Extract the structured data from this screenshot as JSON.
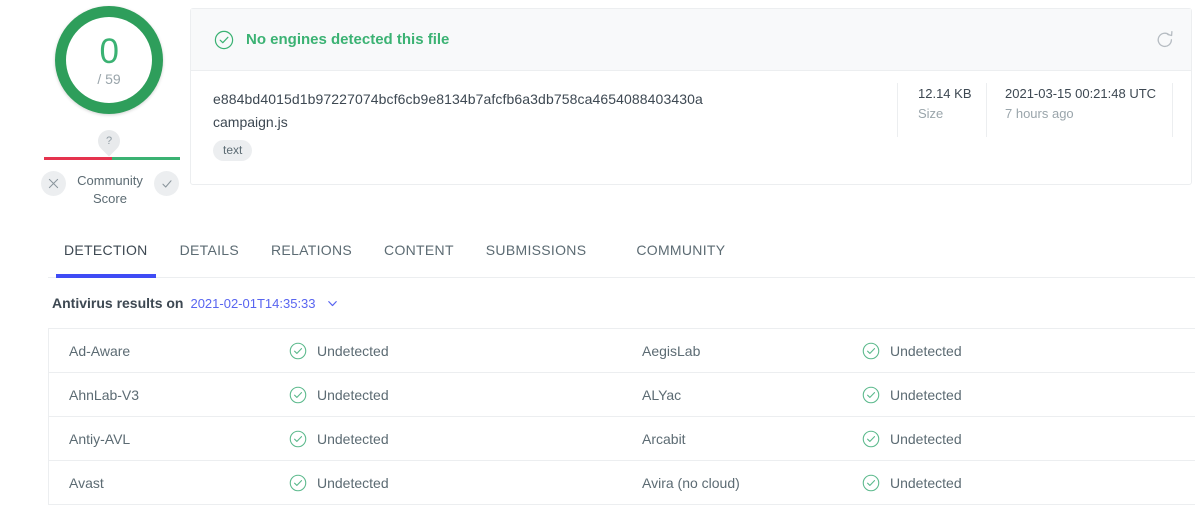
{
  "score": {
    "detections": "0",
    "total": "/ 59",
    "ring_color": "#2e9e5b",
    "count_color": "#3bb273"
  },
  "community": {
    "pin_label": "?",
    "label": "Community Score",
    "negative_icon": "close-icon",
    "positive_icon": "check-icon",
    "bar_negative_color": "#e5334e",
    "bar_positive_color": "#3bb273"
  },
  "verdict": {
    "icon": "check-circle-icon",
    "text": "No engines detected this file",
    "color": "#3bb273",
    "reload_icon": "reload-icon"
  },
  "file": {
    "hash": "e884bd4015d1b97227074bcf6cb9e8134b7afcfb6a3db758ca4654088403430a",
    "name": "campaign.js",
    "tag": "text",
    "meta": [
      {
        "value": "12.14 KB",
        "label": "Size"
      },
      {
        "value": "2021-03-15 00:21:48 UTC",
        "label": "7 hours ago"
      }
    ]
  },
  "tabs": [
    {
      "label": "DETECTION",
      "active": true
    },
    {
      "label": "DETAILS",
      "active": false
    },
    {
      "label": "RELATIONS",
      "active": false
    },
    {
      "label": "CONTENT",
      "active": false
    },
    {
      "label": "SUBMISSIONS",
      "active": false
    },
    {
      "label": "COMMUNITY",
      "active": false
    }
  ],
  "active_tab_color": "#3f4cf5",
  "results": {
    "title": "Antivirus results on",
    "date": "2021-02-01T14:35:33",
    "chevron_icon": "chevron-down-icon",
    "rows": [
      {
        "left": {
          "engine": "Ad-Aware",
          "status": "Undetected",
          "icon": "check-circle-icon"
        },
        "right": {
          "engine": "AegisLab",
          "status": "Undetected",
          "icon": "check-circle-icon"
        }
      },
      {
        "left": {
          "engine": "AhnLab-V3",
          "status": "Undetected",
          "icon": "check-circle-icon"
        },
        "right": {
          "engine": "ALYac",
          "status": "Undetected",
          "icon": "check-circle-icon"
        }
      },
      {
        "left": {
          "engine": "Antiy-AVL",
          "status": "Undetected",
          "icon": "check-circle-icon"
        },
        "right": {
          "engine": "Arcabit",
          "status": "Undetected",
          "icon": "check-circle-icon"
        }
      },
      {
        "left": {
          "engine": "Avast",
          "status": "Undetected",
          "icon": "check-circle-icon"
        },
        "right": {
          "engine": "Avira (no cloud)",
          "status": "Undetected",
          "icon": "check-circle-icon"
        }
      }
    ]
  }
}
